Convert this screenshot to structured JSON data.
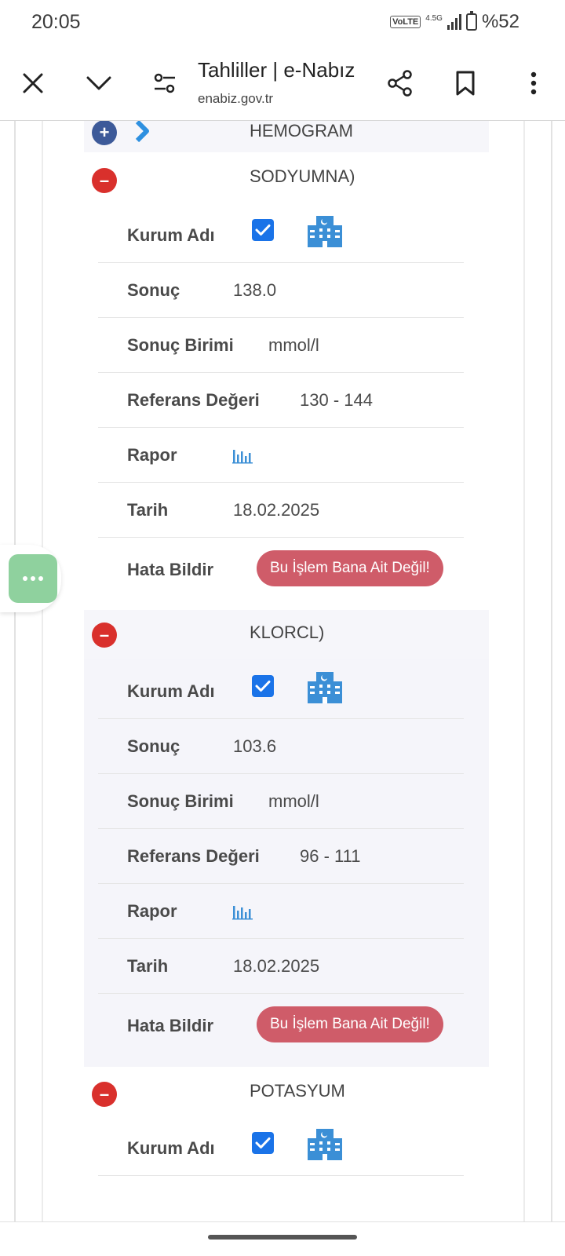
{
  "status_bar": {
    "time": "20:05",
    "volte": "VoLTE",
    "network": "4.5G",
    "battery": "%52"
  },
  "toolbar": {
    "title": "Tahliller | e-Nabız",
    "url": "enabiz.gov.tr",
    "icons": [
      "close-icon",
      "chevron-down-icon",
      "tune-icon",
      "share-icon",
      "bookmark-icon",
      "more-vert-icon"
    ]
  },
  "labels": {
    "kurum": "Kurum Adı",
    "sonuc": "Sonuç",
    "birim": "Sonuç Birimi",
    "referans": "Referans Değeri",
    "rapor": "Rapor",
    "tarih": "Tarih",
    "hata": "Hata Bildir",
    "error_button": "Bu İşlem Bana Ait Değil!"
  },
  "tests": [
    {
      "name": "HEMOGRAM",
      "expanded": false
    },
    {
      "name": "SODYUMNA)",
      "expanded": true,
      "sonuc": "138.0",
      "birim": "mmol/l",
      "referans": "130 - 144",
      "tarih": "18.02.2025"
    },
    {
      "name": "KLORCL)",
      "expanded": true,
      "sonuc": "103.6",
      "birim": "mmol/l",
      "referans": "96 - 111",
      "tarih": "18.02.2025"
    },
    {
      "name": "POTASYUM",
      "expanded": true
    }
  ],
  "colors": {
    "plus_circle": "#3d5a99",
    "minus_circle": "#d9302c",
    "error_button": "#cf5c69",
    "checkbox": "#1a73e8",
    "fab": "#8fd19e"
  }
}
